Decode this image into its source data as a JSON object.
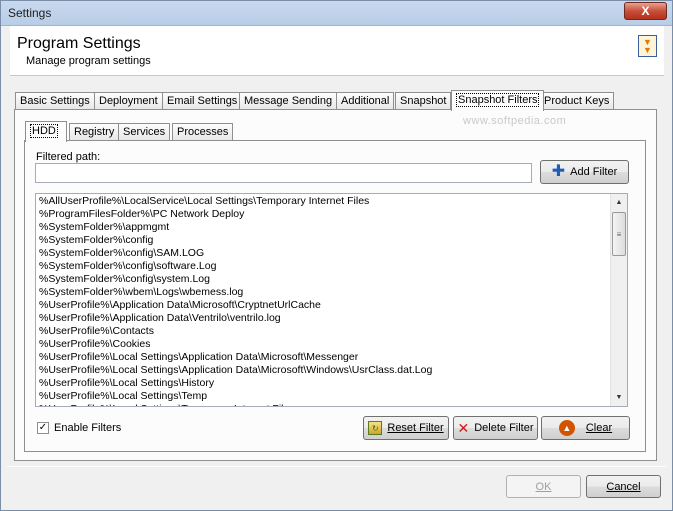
{
  "window": {
    "title": "Settings",
    "close_label": "X"
  },
  "header": {
    "title": "Program Settings",
    "subtitle": "Manage program settings",
    "icon": "arrows-down-icon"
  },
  "outer_tabs": [
    {
      "label": "Basic Settings"
    },
    {
      "label": "Deployment"
    },
    {
      "label": "Email Settings"
    },
    {
      "label": "Message Sending"
    },
    {
      "label": "Additional"
    },
    {
      "label": "Snapshot"
    },
    {
      "label": "Snapshot Filters"
    },
    {
      "label": "Product Keys"
    }
  ],
  "active_outer_tab": "Snapshot Filters",
  "watermark": "www.softpedia.com",
  "inner_tabs": [
    {
      "label": "HDD"
    },
    {
      "label": "Registry"
    },
    {
      "label": "Services"
    },
    {
      "label": "Processes"
    }
  ],
  "active_inner_tab": "HDD",
  "filter_form": {
    "label": "Filtered path:",
    "value": "",
    "add_button": "Add Filter"
  },
  "filters": [
    "%AllUserProfile%\\LocalService\\Local Settings\\Temporary Internet Files",
    "%ProgramFilesFolder%\\PC Network Deploy",
    "%SystemFolder%\\appmgmt",
    "%SystemFolder%\\config",
    "%SystemFolder%\\config\\SAM.LOG",
    "%SystemFolder%\\config\\software.Log",
    "%SystemFolder%\\config\\system.Log",
    "%SystemFolder%\\wbem\\Logs\\wbemess.log",
    "%UserProfile%\\Application Data\\Microsoft\\CryptnetUrlCache",
    "%UserProfile%\\Application Data\\Ventrilo\\ventrilo.log",
    "%UserProfile%\\Contacts",
    "%UserProfile%\\Cookies",
    "%UserProfile%\\Local Settings\\Application Data\\Microsoft\\Messenger",
    "%UserProfile%\\Local Settings\\Application Data\\Microsoft\\Windows\\UsrClass.dat.Log",
    "%UserProfile%\\Local Settings\\History",
    "%UserProfile%\\Local Settings\\Temp",
    "%UserProfile%\\Local Settings\\Temporary Internet Files"
  ],
  "enable_filters": {
    "label": "Enable Filters",
    "checked": true,
    "mark": "✓"
  },
  "buttons": {
    "reset": "Reset Filter",
    "delete": "Delete Filter",
    "clear": "Clear",
    "ok": "OK",
    "cancel": "Cancel"
  },
  "colors": {
    "accent": "#1b5fb8",
    "delete": "#d3180f",
    "clear": "#d35400"
  }
}
